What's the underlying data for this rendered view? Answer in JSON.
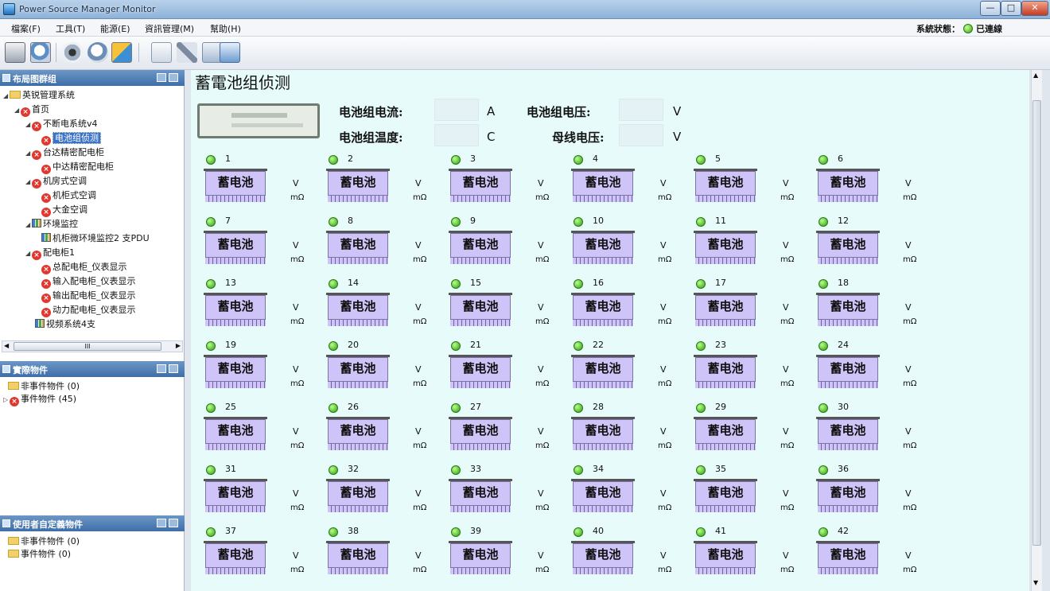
{
  "window": {
    "title": "Power Source Manager Monitor"
  },
  "menu": {
    "items": [
      "檔案(F)",
      "工具(T)",
      "能源(E)",
      "資訊管理(M)",
      "幫助(H)"
    ],
    "status_label": "系統狀態：",
    "status_value": "已連線"
  },
  "toolbar": {
    "buttons": [
      "log-icon",
      "search-icon",
      "camera-icon",
      "zoom-icon",
      "config-icon",
      "edit-icon",
      "tools-icon",
      "network-icon",
      "window-icon"
    ]
  },
  "left": {
    "layout_panel": {
      "title": "布局图群组",
      "tree": [
        {
          "label": "英锐管理系统"
        },
        {
          "label": "首页"
        },
        {
          "label": "不断电系统v4"
        },
        {
          "label": "电池组侦测"
        },
        {
          "label": "台达精密配电柜"
        },
        {
          "label": "中达精密配电柜"
        },
        {
          "label": "机房式空调"
        },
        {
          "label": "机柜式空调"
        },
        {
          "label": "大金空调"
        },
        {
          "label": "环境监控"
        },
        {
          "label": "机柜微环境监控2 支PDU"
        },
        {
          "label": "配电柜1"
        },
        {
          "label": "总配电柜_仪表显示"
        },
        {
          "label": "输入配电柜_仪表显示"
        },
        {
          "label": "输出配电柜_仪表显示"
        },
        {
          "label": "动力配电柜_仪表显示"
        },
        {
          "label": "视频系统4支"
        }
      ]
    },
    "real_panel": {
      "title": "實際物件",
      "tree": [
        {
          "label": "非事件物件 (0)"
        },
        {
          "label": "事件物件 (45)"
        }
      ]
    },
    "user_panel": {
      "title": "使用者自定義物件",
      "tree": [
        {
          "label": "非事件物件 (0)"
        },
        {
          "label": "事件物件 (0)"
        }
      ]
    },
    "scroll_mark": "III"
  },
  "main": {
    "title": "蓄電池组侦测",
    "summary": {
      "current_label": "电池组电流:",
      "current_unit": "A",
      "voltage_label": "电池组电压:",
      "voltage_unit": "V",
      "temp_label": "电池组温度:",
      "temp_unit": "C",
      "bus_label": "母线电压:",
      "bus_unit": "V"
    },
    "battery_label": "蓄电池",
    "unit_v": "V",
    "unit_mohm": "mΩ",
    "batteries": [
      "1",
      "2",
      "3",
      "4",
      "5",
      "6",
      "7",
      "8",
      "9",
      "10",
      "11",
      "12",
      "13",
      "14",
      "15",
      "16",
      "17",
      "18",
      "19",
      "20",
      "21",
      "22",
      "23",
      "24",
      "25",
      "26",
      "27",
      "28",
      "29",
      "30",
      "31",
      "32",
      "33",
      "34",
      "35",
      "36",
      "37",
      "38",
      "39",
      "40",
      "41",
      "42"
    ],
    "led_color": "#2d9a14",
    "background_color": "#e7fbfb"
  }
}
